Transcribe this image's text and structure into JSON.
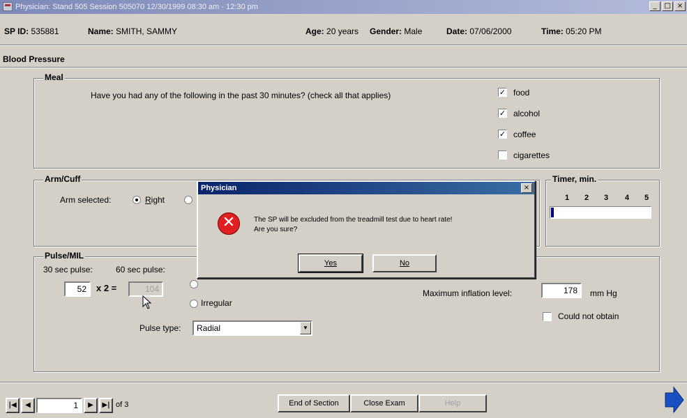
{
  "window": {
    "title": "Physician: Stand 505 Session 505070 12/30/1999 08:30 am - 12:30 pm",
    "buttons": {
      "minimize": "_",
      "maximize": "□",
      "close": "×"
    }
  },
  "info": {
    "sp_id_label": "SP ID:",
    "sp_id": "535881",
    "name_label": "Name:",
    "name": "SMITH, SAMMY",
    "age_label": "Age:",
    "age": "20 years",
    "gender_label": "Gender:",
    "gender": "Male",
    "date_label": "Date:",
    "date": "07/06/2000",
    "time_label": "Time:",
    "time": "05:20 PM"
  },
  "section": {
    "title": "Blood Pressure"
  },
  "meal": {
    "title": "Meal",
    "question": "Have you had any of the following in the past 30 minutes? (check all that applies)",
    "options": [
      {
        "label": "food",
        "checked": true,
        "mark": "✓"
      },
      {
        "label": "alcohol",
        "checked": true,
        "mark": "✓"
      },
      {
        "label": "coffee",
        "checked": true,
        "mark": "✓"
      },
      {
        "label": "cigarettes",
        "checked": false,
        "mark": ""
      }
    ]
  },
  "arm_cuff": {
    "title": "Arm/Cuff",
    "arm_selected_label": "Arm selected:",
    "right_label": "Right",
    "right_underline": "R",
    "right_rest": "ight"
  },
  "timer": {
    "title": "Timer, min.",
    "ticks": [
      "1",
      "2",
      "3",
      "4",
      "5"
    ],
    "progress": 0.03
  },
  "pulse": {
    "title": "Pulse/MIL",
    "sec30_label": "30 sec pulse:",
    "sec60_label": "60 sec pulse:",
    "value_30": "52",
    "multiplier": "x 2 =",
    "value_60": "104",
    "irregular_label": "Irregular",
    "pulse_type_label": "Pulse type:",
    "pulse_type_value": "Radial",
    "max_inflation_label": "Maximum inflation level:",
    "max_inflation_value": "178",
    "unit": "mm Hg",
    "could_not_obtain_label": "Could not obtain"
  },
  "nav": {
    "first": "|◀",
    "prev": "◀",
    "page": "1",
    "next": "▶",
    "last": "▶|",
    "of_label": "of 3"
  },
  "footer": {
    "end_of_section": "End of Section",
    "close_exam": "Close Exam",
    "third_button": "Help"
  },
  "dialog": {
    "title": "Physician",
    "close": "×",
    "line1": "The SP will be excluded from the treadmill test due to heart rate!",
    "line2": "Are you sure?",
    "yes": "Yes",
    "no": "No"
  },
  "colors": {
    "window_bg": "#d4d0c8",
    "dialog_title": "#0a246a",
    "error_icon": "#e02020",
    "next_arrow": "#1a4fc4"
  }
}
